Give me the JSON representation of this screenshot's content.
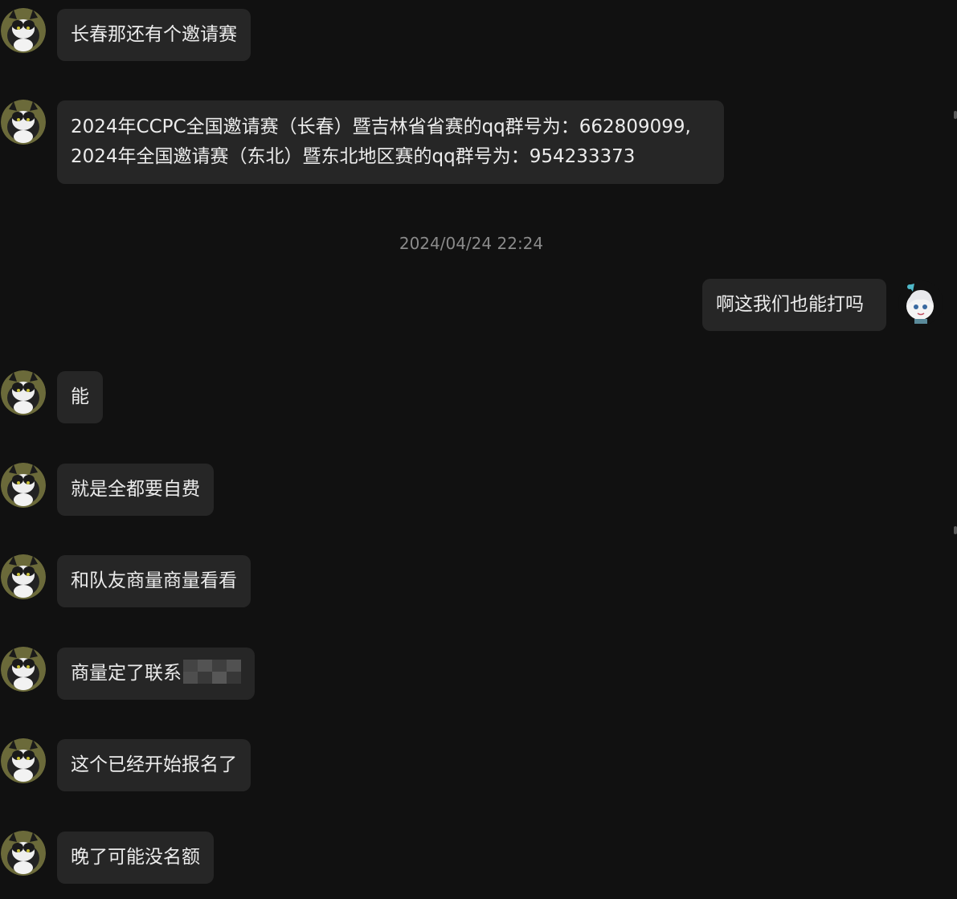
{
  "messages": [
    {
      "side": "left",
      "lines": [
        "长春那还有个邀请赛"
      ]
    },
    {
      "side": "left",
      "lines": [
        "2024年CCPC全国邀请赛（长春）暨吉林省省赛的qq群号为：662809099,",
        "2024年全国邀请赛（东北）暨东北地区赛的qq群号为：954233373"
      ]
    },
    {
      "side": "right",
      "lines": [
        "啊这我们也能打吗"
      ]
    },
    {
      "side": "left",
      "lines": [
        "能"
      ]
    },
    {
      "side": "left",
      "lines": [
        "就是全都要自费"
      ]
    },
    {
      "side": "left",
      "lines": [
        "和队友商量商量看看"
      ]
    },
    {
      "side": "left",
      "lines": [
        "商量定了联系"
      ],
      "redacted_suffix": true
    },
    {
      "side": "left",
      "lines": [
        "这个已经开始报名了"
      ]
    },
    {
      "side": "left",
      "lines": [
        "晚了可能没名额"
      ]
    }
  ],
  "timestamp": "2024/04/24 22:24",
  "colors": {
    "background": "#111111",
    "bubble": "#262626",
    "text": "#ececec",
    "timestamp": "#8a8a8a"
  },
  "icons": {
    "left_avatar": "cat-avatar-icon",
    "right_avatar": "anime-girl-avatar-icon"
  }
}
